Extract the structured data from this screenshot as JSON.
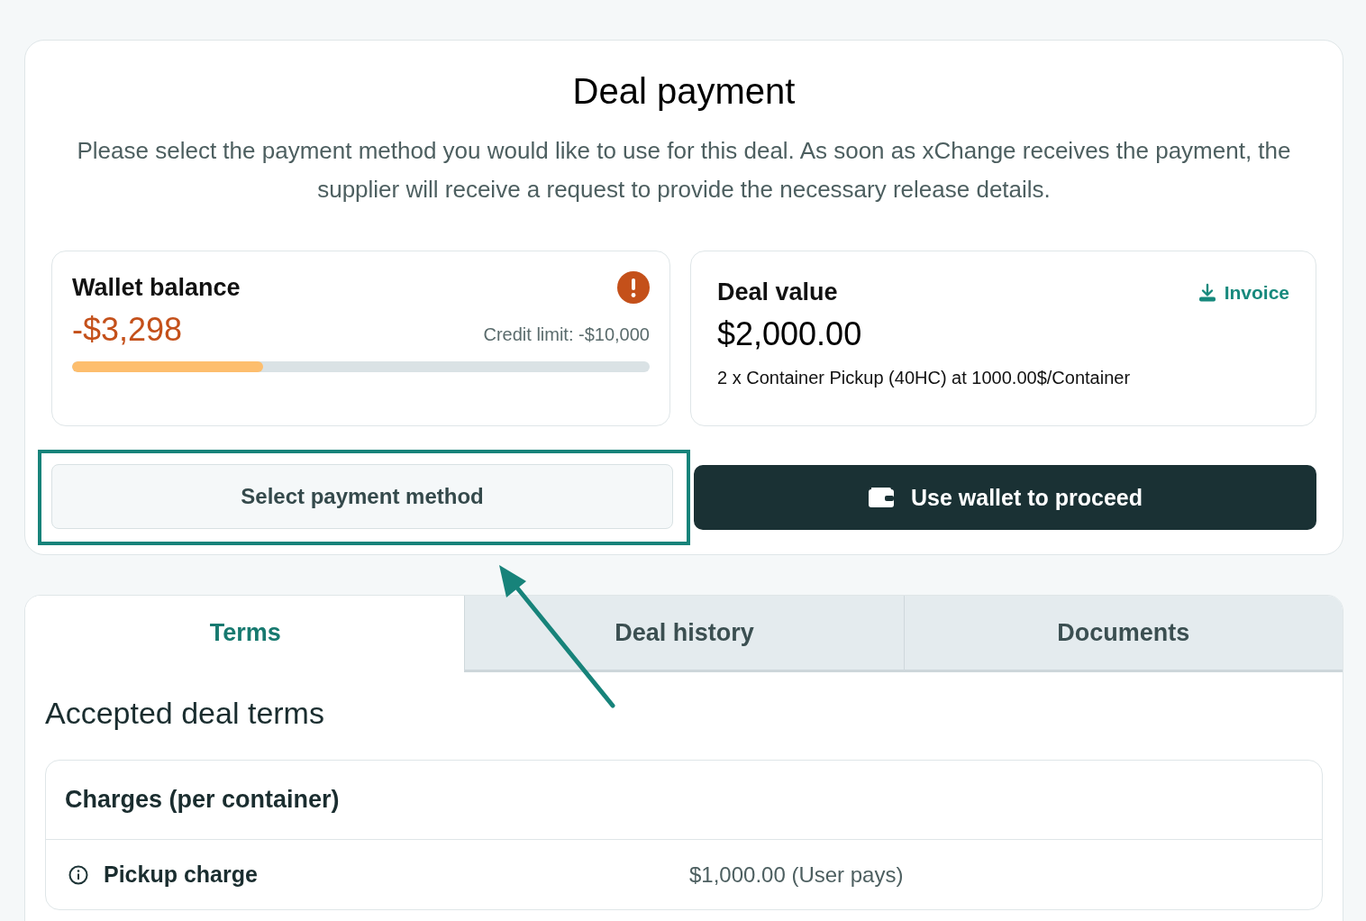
{
  "payment": {
    "title": "Deal payment",
    "description": "Please select the payment method you would like to use for this deal. As soon as xChange receives the payment, the supplier will receive a request to provide the necessary release details.",
    "wallet": {
      "label": "Wallet balance",
      "amount": "-$3,298",
      "credit_limit": "Credit limit: -$10,000",
      "level": 0.33,
      "warning": true
    },
    "deal_value": {
      "label": "Deal value",
      "amount": "$2,000.00",
      "link": "Invoice",
      "detail": "2 x Container Pickup (40HC) at 1000.00$/Container"
    },
    "buttons": [
      {
        "label": "Select payment method",
        "kind": "secondary",
        "highlighted": true
      },
      {
        "label": "Use wallet to proceed",
        "kind": "primary",
        "highlighted": false
      }
    ]
  },
  "tabs": [
    {
      "label": "Terms",
      "selected": true
    },
    {
      "label": "Deal history",
      "selected": false
    },
    {
      "label": "Documents",
      "selected": false
    }
  ],
  "terms": {
    "heading": "Accepted deal terms",
    "section_title": "Charges (per container)",
    "rows": [
      {
        "label": "Pickup charge",
        "value": "$1,000.00 (User pays)"
      }
    ]
  }
}
